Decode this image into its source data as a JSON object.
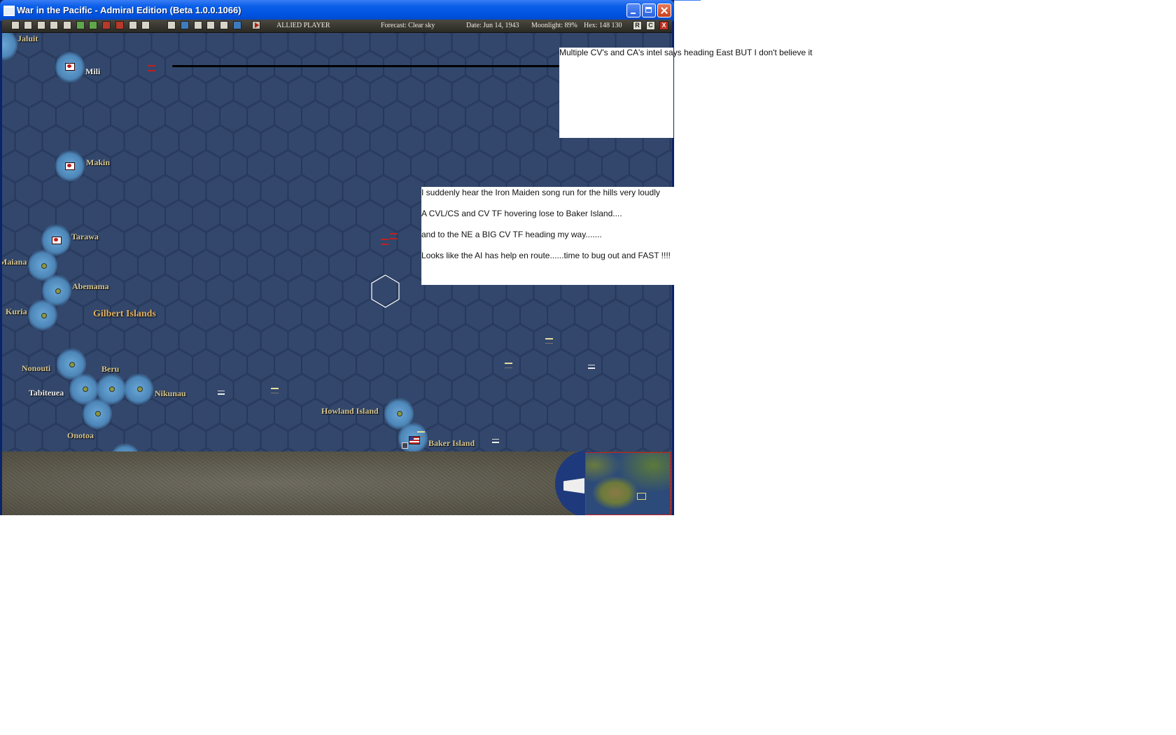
{
  "window": {
    "title": "War in the Pacific - Admiral Edition (Beta 1.0.0.1066)"
  },
  "toolbar": {
    "player": "ALLIED PLAYER",
    "forecast": "Forecast: Clear sky",
    "date": "Date: Jun 14, 1943",
    "moonlight": "Moonlight: 89%",
    "hex": "Hex: 148 130",
    "right_buttons": [
      "R",
      "C",
      "X"
    ]
  },
  "map": {
    "places": {
      "jaluit": "Jaluit",
      "mili": "Mili",
      "makin": "Makin",
      "tarawa": "Tarawa",
      "maiana": "Maiana",
      "abemama": "Abemama",
      "kuria": "Kuria",
      "nonouti": "Nonouti",
      "beru": "Beru",
      "tabiteuea": "Tabiteuea",
      "nikunau": "Nikunau",
      "onotoa": "Onotoa",
      "howland": "Howland Island",
      "baker": "Baker Island"
    },
    "region": "Gilbert Islands",
    "colors": {
      "sea": "#32476b",
      "hex_line": "#26375a",
      "japanese": "#c01818",
      "allied_flag": "US"
    }
  },
  "annotations": {
    "note1": "Multiple CV's and CA's intel says heading East BUT I don't believe it",
    "note2": [
      "I suddenly hear the Iron Maiden song run for the hills very loudly",
      "A CVL/CS and CV TF hovering lose to Baker Island....",
      "and to the NE a BIG CV TF heading my way.......",
      "Looks like the AI has help en route......time to bug out and FAST !!!!"
    ]
  }
}
